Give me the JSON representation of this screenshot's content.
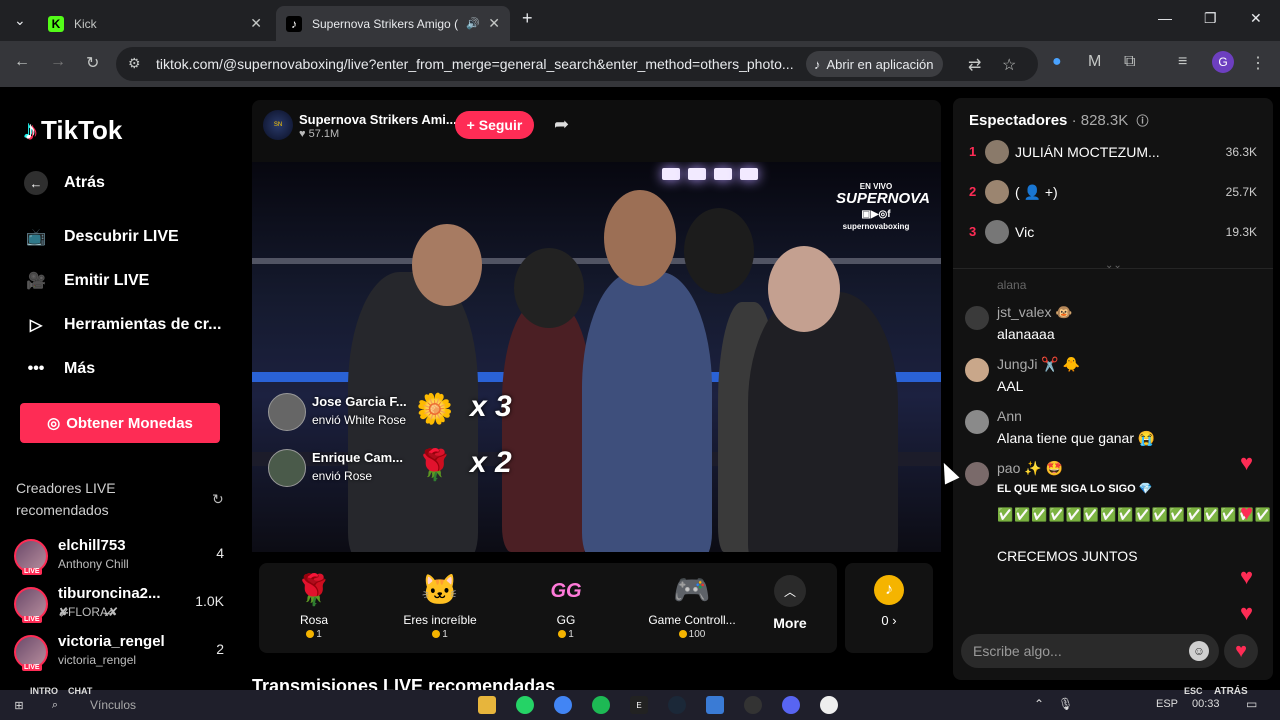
{
  "browser": {
    "tabs": [
      {
        "title": "Kick",
        "favicon": "K"
      },
      {
        "title": "Supernova Strikers Amigo (",
        "favicon": "♪"
      }
    ],
    "url": "tiktok.com/@supernovaboxing/live?enter_from_merge=general_search&enter_method=others_photo...",
    "open_app_label": "Abrir en aplicación",
    "profile_initial": "G"
  },
  "sidebar": {
    "logo": "TikTok",
    "back": "Atrás",
    "items": [
      {
        "label": "Descubrir LIVE",
        "icon": "discover-live-icon"
      },
      {
        "label": "Emitir LIVE",
        "icon": "camera-icon"
      },
      {
        "label": "Herramientas de cr...",
        "icon": "creator-tools-icon"
      },
      {
        "label": "Más",
        "icon": "more-dots-icon"
      }
    ],
    "coins_button": "Obtener Monedas",
    "creators_title": "Creadores LIVE recomendados",
    "creators": [
      {
        "name": "elchill753",
        "sub": "Anthony Chill",
        "count": "4"
      },
      {
        "name": "tiburoncina2...",
        "sub": "✘̶̷̶̷̶̷̶̷FLORA̶̷̶̷̶̷̶̷✘",
        "count": "1.0K"
      },
      {
        "name": "victoria_rengel",
        "sub": "victoria_rengel",
        "count": "2"
      }
    ]
  },
  "stream": {
    "host_name": "Supernova Strikers Ami...",
    "host_likes": "♥ 57.1M",
    "follow_label": "+ Seguir",
    "brand_top": "EN VIVO",
    "brand_name": "SUPERNOVA",
    "brand_handle": "supernovaboxing",
    "gift_events": [
      {
        "name": "Jose Garcia F...",
        "action": "envió White Rose",
        "icon": "🌼",
        "mult": "x 3"
      },
      {
        "name": "Enrique Cam...",
        "action": "envió Rose",
        "icon": "🌹",
        "mult": "x 2"
      }
    ]
  },
  "gifts": [
    {
      "label": "Rosa",
      "price": "1",
      "icon": "🌹"
    },
    {
      "label": "Eres increíble",
      "price": "1",
      "icon": "🐱"
    },
    {
      "label": "GG",
      "price": "1",
      "icon": "GG"
    },
    {
      "label": "Game Controll...",
      "price": "100",
      "icon": "🎮"
    }
  ],
  "more_label": "More",
  "coin_balance": "0 ›",
  "recommended_title": "Transmisiones LIVE recomendadas",
  "chat": {
    "viewers_label": "Espectadores",
    "viewers_count": "· 828.3K",
    "viewers": [
      {
        "rank": "1",
        "name": "JULIÁN MOCTEZUM...",
        "count": "36.3K"
      },
      {
        "rank": "2",
        "name": "( 👤 +)",
        "count": "25.7K"
      },
      {
        "rank": "3",
        "name": "Vic",
        "count": "19.3K"
      }
    ],
    "faded_user": "alana",
    "messages": [
      {
        "user": "jst_valex 🐵",
        "text": "alanaaaa"
      },
      {
        "user": "JungJi ✂️ 🐥",
        "text": "AAL"
      },
      {
        "user": "Ann",
        "text": "Alana tiene que ganar 😭"
      },
      {
        "user": "pao ✨ 🤩",
        "text": "EL QUE ME SIGA LO SIGO 💎",
        "checks": "✅✅✅✅✅✅✅✅✅✅✅✅✅✅✅✅✅✅✅✅✅",
        "extra": "CRECEMOS JUNTOS"
      }
    ],
    "input_placeholder": "Escribe algo..."
  },
  "taskbar": {
    "search": "Vínculos",
    "lang": "ESP",
    "time": "00:33",
    "overlay_left_1": "INTRO",
    "overlay_left_2": "CHAT",
    "overlay_right_1": "ESC",
    "overlay_right_2": "ATRÁS"
  }
}
